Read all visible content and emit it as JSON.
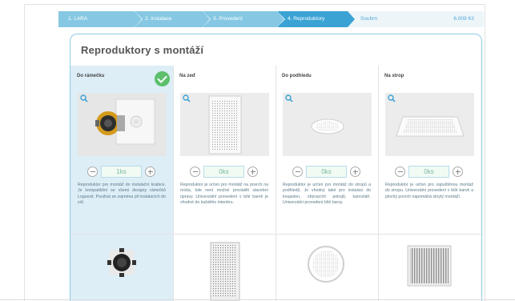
{
  "wizard": {
    "steps": [
      {
        "label": "1. LARA"
      },
      {
        "label": "2. Instalace"
      },
      {
        "label": "3. Provedení"
      },
      {
        "label": "4. Reproduktory"
      },
      {
        "label": "Souhrn"
      }
    ],
    "total": "6.009 Kč"
  },
  "section": {
    "title": "Reproduktory s montáží",
    "products": [
      {
        "label": "Do rámečku",
        "selected": true,
        "quantity": "1ks",
        "description": "Reproduktor pro montáž do instalační krabice. Je kompatibilní se všemi designy rámečků Loguesit. Použivá se zejména při instalacích do zdí."
      },
      {
        "label": "Na zeď",
        "selected": false,
        "quantity": "0ks",
        "description": "Reproduktor je určen pro montáž na povrch na místa, kde není možné provádět stavební úpravy. Univerzální provedení v bílé barvě je vhodné do každého interiéru."
      },
      {
        "label": "Do podhledu",
        "selected": false,
        "quantity": "0ks",
        "description": "Reproduktor je určen pro montáž do stropů a podhledů. Je vhodný také pro instalaci do koupelen, obývacích pokojů, kanceláří. Univerzální provedení bílé barvy."
      },
      {
        "label": "Na strop",
        "selected": false,
        "quantity": "0ks",
        "description": "Reproduktor je určen pro zapuštěnou montáž do stropu. Univerzální provedení v bílé barvě a plochý povrch napomáhá skrytý montáží."
      }
    ]
  },
  "icons": {
    "zoom": "magnifier-icon",
    "selected": "checkmark-icon",
    "minus": "minus-circle-icon",
    "plus": "plus-circle-icon"
  },
  "colors": {
    "accent": "#3aa3d4",
    "step": "#86c8e3",
    "selected_bg": "#ddeef7",
    "check": "#5bbf6b"
  }
}
